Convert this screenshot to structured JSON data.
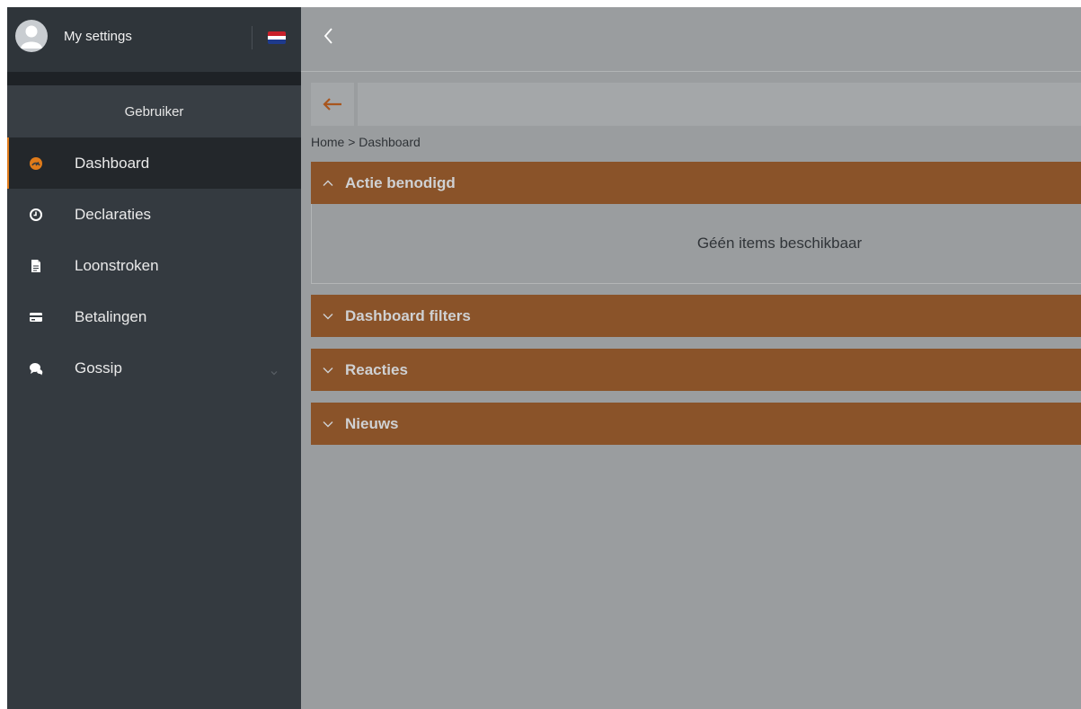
{
  "header": {
    "settings_label": "My settings",
    "language_flag": "flag-netherlands-icon"
  },
  "sidebar": {
    "section_label": "Gebruiker",
    "items": [
      {
        "label": "Dashboard",
        "icon": "dashboard-gauge-icon",
        "active": true
      },
      {
        "label": "Declaraties",
        "icon": "clock-icon",
        "active": false
      },
      {
        "label": "Loonstroken",
        "icon": "document-icon",
        "active": false
      },
      {
        "label": "Betalingen",
        "icon": "credit-card-icon",
        "active": false
      },
      {
        "label": "Gossip",
        "icon": "chat-bubbles-icon",
        "active": false,
        "expandable": true
      }
    ]
  },
  "main": {
    "breadcrumb": "Home > Dashboard",
    "panels": [
      {
        "title": "Actie benodigd",
        "expanded": true,
        "empty_message": "Géén items beschikbaar"
      },
      {
        "title": "Dashboard filters",
        "expanded": false
      },
      {
        "title": "Reacties",
        "expanded": false
      },
      {
        "title": "Nieuws",
        "expanded": false
      }
    ]
  },
  "colors": {
    "sidebar_bg": "#343a40",
    "active_accent": "#e07b1a",
    "panel_header_bg": "#8a5329",
    "main_bg": "#9a9d9f",
    "back_arrow": "#a8561e"
  }
}
